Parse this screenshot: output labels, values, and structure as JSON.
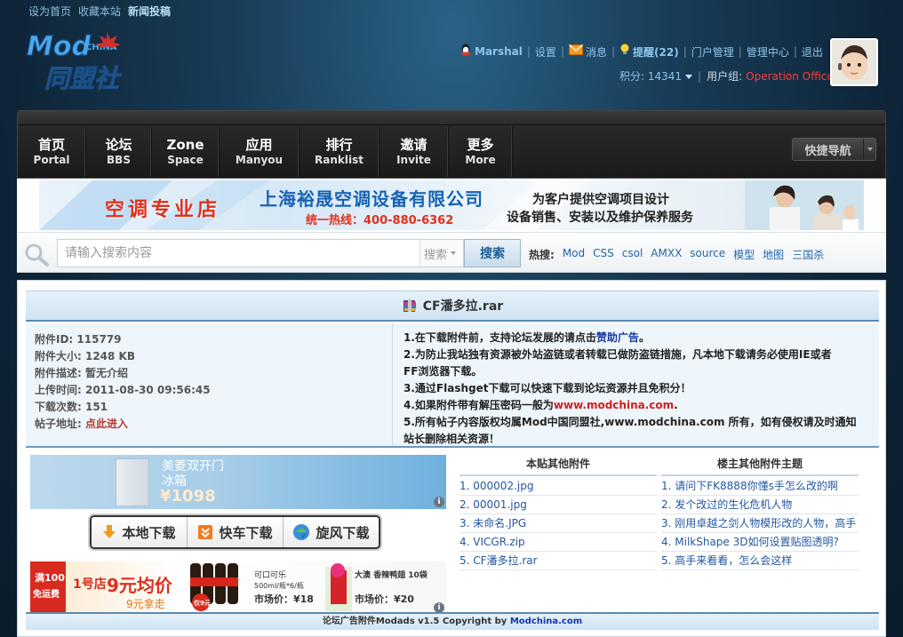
{
  "top_links": [
    "设为首页",
    "收藏本站",
    "新闻投稿"
  ],
  "logo": {
    "text": "Mod同盟社",
    "small": "CHINA"
  },
  "user": {
    "username": "Marshal",
    "settings": "设置",
    "messages": "消息",
    "reminders": "提醒(22)",
    "portal_admin": "门户管理",
    "admin_center": "管理中心",
    "logout": "退出",
    "points_label": "积分: 14341",
    "group_label": "用户组:",
    "group_value": "Operation Officer"
  },
  "nav": [
    {
      "cn": "首页",
      "en": "Portal"
    },
    {
      "cn": "论坛",
      "en": "BBS"
    },
    {
      "cn": "Zone",
      "en": "Space"
    },
    {
      "cn": "应用",
      "en": "Manyou"
    },
    {
      "cn": "排行",
      "en": "Ranklist"
    },
    {
      "cn": "邀请",
      "en": "Invite"
    },
    {
      "cn": "更多",
      "en": "More"
    }
  ],
  "quick_nav": "快捷导航",
  "banner": {
    "left": "空调专业店",
    "company": "上海裕晟空调设备有限公司",
    "hotline": "统一热线：400-880-6362",
    "right_line1": "为客户提供空调项目设计",
    "right_line2": "设备销售、安装以及维护保养服务"
  },
  "search": {
    "placeholder": "请输入搜索内容",
    "select_value": "搜索",
    "button": "搜索",
    "hot_label": "热搜:",
    "hot_items": [
      "Mod",
      "CSS",
      "csol",
      "AMXX",
      "source",
      "模型",
      "地图",
      "三国杀"
    ]
  },
  "attachment": {
    "filename": "CF潘多拉.rar",
    "info": [
      {
        "label": "附件ID: ",
        "value": "115779"
      },
      {
        "label": "附件大小: ",
        "value": "1248 KB"
      },
      {
        "label": "附件描述: ",
        "value": "暂无介绍"
      },
      {
        "label": "上传时间: ",
        "value": "2011-08-30 09:56:45"
      },
      {
        "label": "下载次数: ",
        "value": "151"
      },
      {
        "label": "帖子地址: ",
        "value": "点此进入"
      }
    ],
    "notes": {
      "n1_pre": "1.在下载附件前，支持论坛发展的请点击",
      "n1_link": "赞助广告",
      "n1_post": "。",
      "n2a": "2.为防止我站独有资源被外站盗链或者转载已做防盗链措施，凡本地下载请务必使用IE或者",
      "n2b": "FF浏览器下载。",
      "n3": "3.通过Flashget下载可以快速下载到论坛资源并且免积分！",
      "n4_pre": "4.如果附件带有解压密码一般为",
      "n4_link": "www.modchina.com",
      "n4_post": ".",
      "n5a": "5.所有帖子内容版权均属Mod中国同盟社,www.modchina.com 所有，如有侵权请及时通知",
      "n5b": "站长删除相关资源！"
    }
  },
  "ad1": {
    "line1": "美菱双开门",
    "line2": "冰箱",
    "price": "¥1098"
  },
  "downloads": [
    "本地下载",
    "快车下载",
    "旋风下载"
  ],
  "ad2": {
    "badge1": "满100",
    "badge2": "免运费",
    "brand": "1号店",
    "promo": "9元均价",
    "promo2": "9元拿走",
    "item1": "可口可乐",
    "item1_spec": "500ml/瓶*6/瓶",
    "item1_price": "市场价：¥18",
    "item2": "大澳 香辣鸭翅 10袋",
    "item2_price": "市场价：¥20",
    "tag": "仅9元"
  },
  "other_attachments": {
    "header": "本贴其他附件",
    "items": [
      "1. 000002.jpg",
      "2. 00001.jpg",
      "3. 未命名.JPG",
      "4. VICGR.zip",
      "5. CF潘多拉.rar"
    ]
  },
  "other_topics": {
    "header": "楼主其他附件主题",
    "items": [
      "1. 请问下FK8888你懂s手怎么改的啊",
      "2. 发个改过的生化危机人物",
      "3. 刚用卓越之剑人物模形改的人物，高手",
      "4. MilkShape 3D如何设置贴图透明?",
      "5. 高手来看看，怎么会这样"
    ]
  },
  "footer": {
    "text": "论坛广告附件Modads v1.5 Copyright by ",
    "link": "Modchina.com"
  },
  "colors": {
    "link": "#2457a0",
    "accent_red": "#d01e1e",
    "title_bar": "#cfe3f3",
    "group": "#ff3b3b"
  },
  "icons": [
    "search-icon",
    "qq-icon",
    "mail-icon",
    "bulb-icon",
    "file-rar-icon",
    "download-arrow-icon",
    "flashget-icon",
    "whirlwind-icon",
    "ad-info-icon"
  ]
}
